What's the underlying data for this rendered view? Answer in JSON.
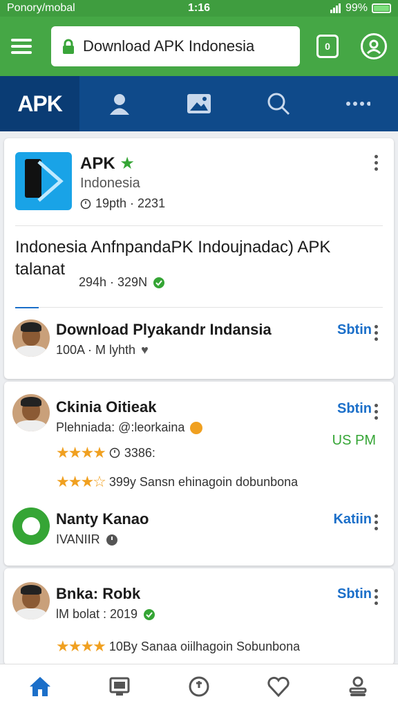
{
  "status_bar": {
    "carrier": "Ponory/mobal",
    "time": "1:16",
    "battery_text": "99%"
  },
  "app_bar": {
    "url_text": "Download APK Indonesia",
    "tab_count": "0"
  },
  "top_tabs": {
    "brand_label": "APK",
    "items": [
      "home",
      "person-icon",
      "image-icon",
      "search-icon",
      "more-icon"
    ]
  },
  "card1": {
    "app_name": "APK",
    "app_subtitle": "Indonesia",
    "app_meta": "19pth · 2231",
    "headline": "Indonesia AnfnpandaPK Indoujnadac) APK talanat",
    "headline_meta": "294h · 329N",
    "row": {
      "title": "Download Plyakandr Indansia",
      "sub": "100A · M lyhth",
      "action": "Sbtin"
    }
  },
  "card2": {
    "row1": {
      "title": "Ckinia Oitieak",
      "sub": "Plehniada: @:leorkaina",
      "action": "Sbtin",
      "time": "US PM",
      "rating_meta": "3386:",
      "review": "399y Sansn ehinagoin dobunbona"
    },
    "row2": {
      "title": "Nanty Kanao",
      "sub": "IVANIIR",
      "action": "Katiin"
    }
  },
  "card3": {
    "title": "Bnka: Robk",
    "sub": "lM bolat : 2019",
    "action": "Sbtin",
    "review": "10By Sanaa oiilhagoin Sobunbona"
  },
  "colors": {
    "app_green": "#45a745",
    "nav_blue": "#0f4a8a",
    "link_blue": "#1b6fc9",
    "star_orange": "#f0a020"
  }
}
